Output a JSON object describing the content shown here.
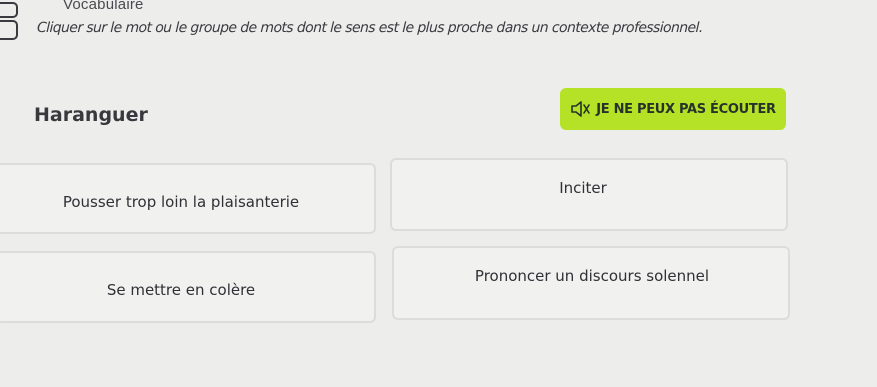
{
  "header": {
    "section_label": "Vocabulaire",
    "instruction": "Cliquer sur le mot ou le groupe de mots dont le sens est le plus proche dans un contexte professionnel."
  },
  "question": {
    "word": "Haranguer",
    "listen_button_label": "JE NE PEUX PAS ÉCOUTER",
    "listen_icon": "speaker-muted-icon"
  },
  "options": [
    {
      "label": "Pousser trop loin la plaisanterie"
    },
    {
      "label": "Inciter"
    },
    {
      "label": "Se mettre en colère"
    },
    {
      "label": "Prononcer un discours solennel"
    }
  ],
  "colors": {
    "accent": "#b5e227",
    "background": "#ededec",
    "option_background": "#f1f1f0"
  }
}
